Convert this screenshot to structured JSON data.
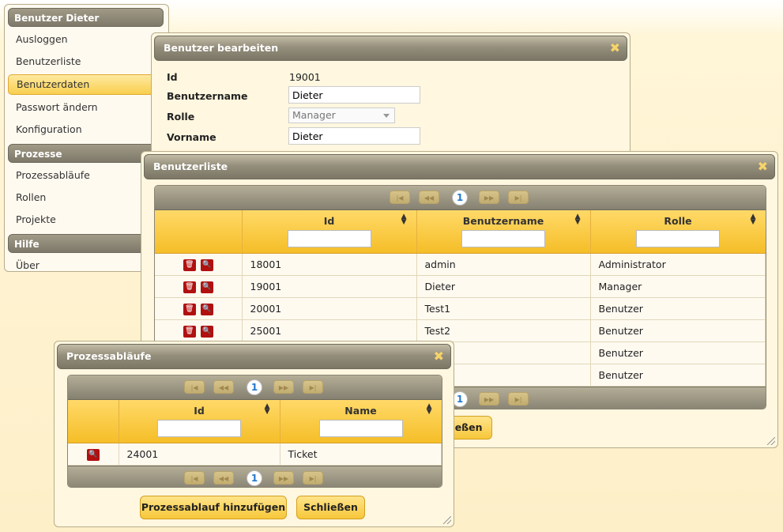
{
  "menu": {
    "sections": [
      {
        "title": "Benutzer Dieter",
        "items": [
          "Ausloggen",
          "Benutzerliste",
          "Benutzerdaten",
          "Passwort ändern",
          "Konfiguration"
        ]
      },
      {
        "title": "Prozesse",
        "items": [
          "Prozessabläufe",
          "Rollen",
          "Projekte"
        ]
      },
      {
        "title": "Hilfe",
        "items": [
          "Über"
        ]
      }
    ],
    "active_item": "Benutzerdaten"
  },
  "edit_dialog": {
    "title": "Benutzer bearbeiten",
    "fields": {
      "id_label": "Id",
      "id_value": "19001",
      "username_label": "Benutzername",
      "username_value": "Dieter",
      "role_label": "Rolle",
      "role_value": "Manager",
      "firstname_label": "Vorname",
      "firstname_value": "Dieter"
    }
  },
  "userlist_dialog": {
    "title": "Benutzerliste",
    "page": "1",
    "columns": [
      "Id",
      "Benutzername",
      "Rolle"
    ],
    "rows": [
      {
        "id": "18001",
        "username": "admin",
        "role": "Administrator"
      },
      {
        "id": "19001",
        "username": "Dieter",
        "role": "Manager"
      },
      {
        "id": "20001",
        "username": "Test1",
        "role": "Benutzer"
      },
      {
        "id": "25001",
        "username": "Test2",
        "role": "Benutzer"
      },
      {
        "id": "",
        "username": "",
        "role": "Benutzer"
      },
      {
        "id": "",
        "username": "",
        "role": "Benutzer"
      }
    ],
    "close_label_partial": "ießen"
  },
  "process_dialog": {
    "title": "Prozessabläufe",
    "page": "1",
    "columns": [
      "Id",
      "Name"
    ],
    "rows": [
      {
        "id": "24001",
        "name": "Ticket"
      }
    ],
    "add_button": "Prozessablauf hinzufügen",
    "close_button": "Schließen"
  },
  "colors": {
    "accent": "#f7c73a",
    "titlebar": "#8a8472",
    "pager_active": "#2277cc"
  }
}
